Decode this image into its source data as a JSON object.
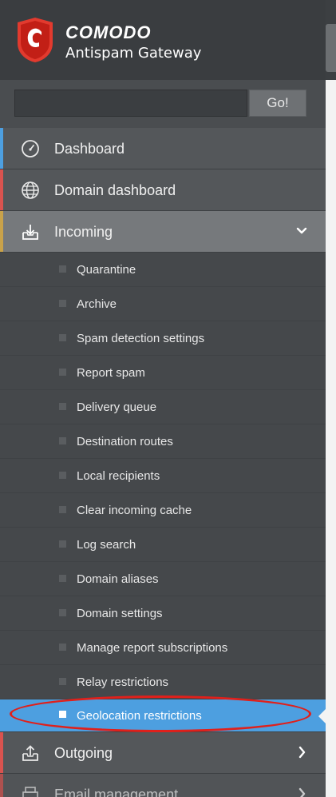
{
  "header": {
    "brand": "COMODO",
    "product": "Antispam Gateway"
  },
  "search": {
    "value": "",
    "placeholder": "",
    "button_label": "Go!"
  },
  "nav": {
    "dashboard": "Dashboard",
    "domain_dashboard": "Domain dashboard",
    "incoming": "Incoming",
    "outgoing": "Outgoing",
    "email_management": "Email management"
  },
  "incoming_submenu": [
    "Quarantine",
    "Archive",
    "Spam detection settings",
    "Report spam",
    "Delivery queue",
    "Destination routes",
    "Local recipients",
    "Clear incoming cache",
    "Log search",
    "Domain aliases",
    "Domain settings",
    "Manage report subscriptions",
    "Relay restrictions",
    "Geolocation restrictions"
  ],
  "active_submenu": "Geolocation restrictions",
  "colors": {
    "sidebar_bg": "#4a4d50",
    "active_item": "#4d9fe0",
    "highlight": "#e0201b",
    "dashboard_accent": "#4d9fe0",
    "domain_accent": "#d9534f",
    "incoming_accent": "#c9a24a",
    "outgoing_accent": "#d9534f"
  }
}
